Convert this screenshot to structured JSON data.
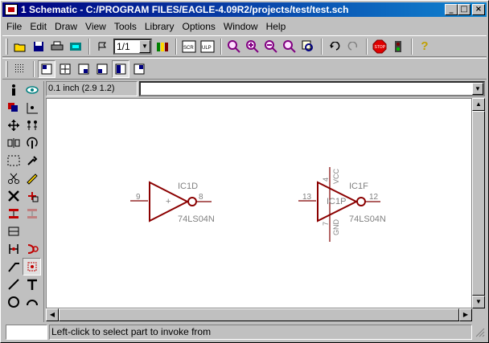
{
  "window": {
    "title": "1 Schematic - C:/PROGRAM FILES/EAGLE-4.09R2/projects/test/test.sch",
    "min_label": "_",
    "max_label": "□",
    "close_label": "×"
  },
  "menu": [
    {
      "label": "File"
    },
    {
      "label": "Edit"
    },
    {
      "label": "Draw"
    },
    {
      "label": "View"
    },
    {
      "label": "Tools"
    },
    {
      "label": "Library"
    },
    {
      "label": "Options"
    },
    {
      "label": "Window"
    },
    {
      "label": "Help"
    }
  ],
  "toolbar": {
    "sheet_value": "1/1",
    "scr_label": "SCR",
    "ulp_label": "ULP",
    "stop_label": "STOP",
    "help_label": "?"
  },
  "coords": {
    "grid": "0.1 inch (2.9 1.2)",
    "command_value": ""
  },
  "parts": [
    {
      "name": "IC1D",
      "value": "74LS04N",
      "pin_in": "9",
      "pin_out": "8"
    },
    {
      "name": "IC1F",
      "value": "74LS04N",
      "pin_in": "13",
      "pin_out": "12",
      "pwr_top": "4",
      "pwr_bot": "7",
      "vcc": "VCC",
      "gnd": "GND",
      "overlap": "IC1P"
    }
  ],
  "status": {
    "message": "Left-click to select part to invoke from"
  },
  "colors": {
    "accent": "#8b0000",
    "pin": "#800000",
    "label": "#808080"
  }
}
